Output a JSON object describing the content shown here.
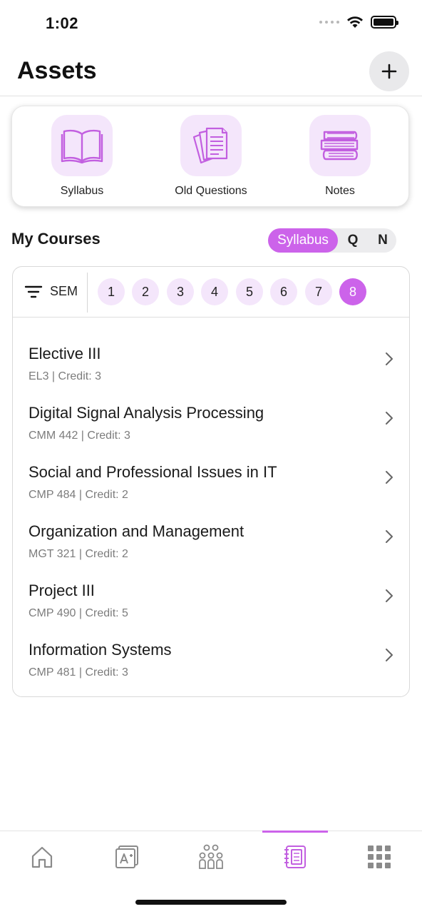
{
  "status_bar": {
    "time": "1:02"
  },
  "header": {
    "title": "Assets"
  },
  "quick_access": [
    {
      "label": "Syllabus",
      "icon": "open-book-icon"
    },
    {
      "label": "Old Questions",
      "icon": "documents-icon"
    },
    {
      "label": "Notes",
      "icon": "book-stack-icon"
    }
  ],
  "courses_section": {
    "title": "My Courses",
    "filter_tabs": [
      "Syllabus",
      "Q",
      "N"
    ],
    "selected_filter": "Syllabus"
  },
  "semester_filter": {
    "label": "SEM",
    "semesters": [
      "1",
      "2",
      "3",
      "4",
      "5",
      "6",
      "7",
      "8"
    ],
    "selected": "8"
  },
  "courses": [
    {
      "name": "Elective III",
      "meta": "EL3 | Credit: 3"
    },
    {
      "name": "Digital Signal Analysis Processing",
      "meta": "CMM 442 | Credit: 3"
    },
    {
      "name": "Social and Professional Issues in IT",
      "meta": "CMP 484 | Credit: 2"
    },
    {
      "name": "Organization and Management",
      "meta": "MGT 321 | Credit: 2"
    },
    {
      "name": "Project III",
      "meta": "CMP 490 | Credit: 5"
    },
    {
      "name": "Information Systems",
      "meta": "CMP 481 | Credit: 3"
    }
  ],
  "tab_bar": {
    "tabs": [
      "home-icon",
      "grades-icon",
      "community-icon",
      "notebook-icon",
      "apps-grid-icon"
    ],
    "active": "notebook-icon"
  },
  "colors": {
    "accent": "#cc63ea",
    "accent_light": "#f4e6fb"
  }
}
